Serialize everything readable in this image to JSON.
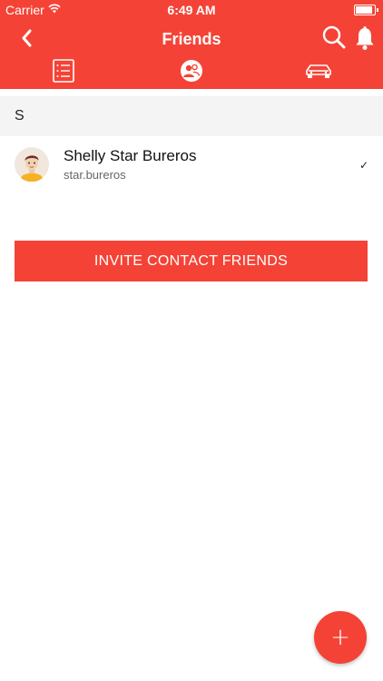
{
  "status_bar": {
    "carrier": "Carrier",
    "time": "6:49 AM",
    "battery_level": 1.0
  },
  "header": {
    "title": "Friends",
    "back_icon": "chevron-left-icon",
    "search_icon": "search-icon",
    "notifications_icon": "bell-icon"
  },
  "tabs": [
    {
      "name": "list",
      "icon": "list-icon"
    },
    {
      "name": "friends",
      "icon": "friends-icon",
      "selected": true
    },
    {
      "name": "car",
      "icon": "car-icon"
    }
  ],
  "section": {
    "letter": "S"
  },
  "friends": [
    {
      "name": "Shelly Star Bureros",
      "username": "star.bureros",
      "checked_mark": "✓"
    }
  ],
  "invite_button": {
    "label": "INVITE CONTACT FRIENDS"
  },
  "fab": {
    "label": "+"
  },
  "colors": {
    "accent": "#f44336",
    "section_bg": "#f4f4f4"
  }
}
